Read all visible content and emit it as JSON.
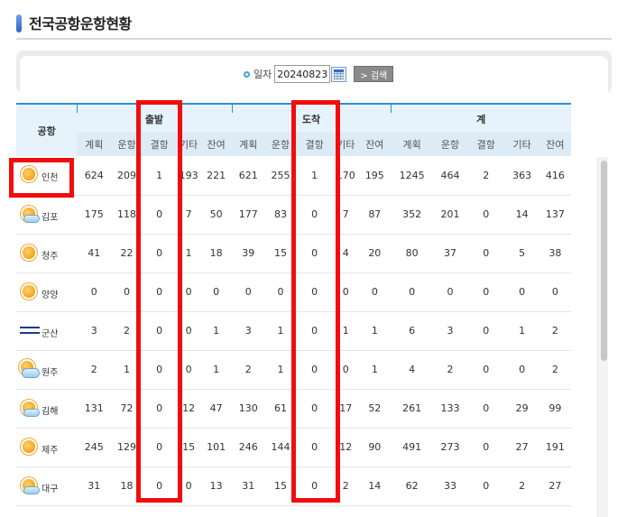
{
  "title": "전국공항운항현황",
  "search": {
    "date_label": "일자",
    "date_value": "20240823",
    "button_label": "> 검색",
    "calendar_icon": "calendar-icon"
  },
  "table": {
    "airport_header": "공항",
    "groups": [
      "출발",
      "도착",
      "계"
    ],
    "subheaders": [
      "계획",
      "운항",
      "결항",
      "기타",
      "잔여"
    ],
    "rows": [
      {
        "airport": "인천",
        "weather": "sunny",
        "dep": [
          "624",
          "209",
          "1",
          "193",
          "221"
        ],
        "arr": [
          "621",
          "255",
          "1",
          "170",
          "195"
        ],
        "tot": [
          "1245",
          "464",
          "2",
          "363",
          "416"
        ]
      },
      {
        "airport": "김포",
        "weather": "partly-cloudy",
        "dep": [
          "175",
          "118",
          "0",
          "7",
          "50"
        ],
        "arr": [
          "177",
          "83",
          "0",
          "7",
          "87"
        ],
        "tot": [
          "352",
          "201",
          "0",
          "14",
          "137"
        ]
      },
      {
        "airport": "청주",
        "weather": "sunny",
        "dep": [
          "41",
          "22",
          "0",
          "1",
          "18"
        ],
        "arr": [
          "39",
          "15",
          "0",
          "4",
          "20"
        ],
        "tot": [
          "80",
          "37",
          "0",
          "5",
          "38"
        ]
      },
      {
        "airport": "양양",
        "weather": "sunny",
        "dep": [
          "0",
          "0",
          "0",
          "0",
          "0"
        ],
        "arr": [
          "0",
          "0",
          "0",
          "0",
          "0"
        ],
        "tot": [
          "0",
          "0",
          "0",
          "0",
          "0"
        ]
      },
      {
        "airport": "군산",
        "weather": "fog",
        "dep": [
          "3",
          "2",
          "0",
          "0",
          "1"
        ],
        "arr": [
          "3",
          "1",
          "0",
          "1",
          "1"
        ],
        "tot": [
          "6",
          "3",
          "0",
          "1",
          "2"
        ]
      },
      {
        "airport": "원주",
        "weather": "cloudy",
        "dep": [
          "2",
          "1",
          "0",
          "0",
          "1"
        ],
        "arr": [
          "2",
          "1",
          "0",
          "0",
          "1"
        ],
        "tot": [
          "4",
          "2",
          "0",
          "0",
          "2"
        ]
      },
      {
        "airport": "김해",
        "weather": "partly-cloudy",
        "dep": [
          "131",
          "72",
          "0",
          "12",
          "47"
        ],
        "arr": [
          "130",
          "61",
          "0",
          "17",
          "52"
        ],
        "tot": [
          "261",
          "133",
          "0",
          "29",
          "99"
        ]
      },
      {
        "airport": "제주",
        "weather": "sunny",
        "dep": [
          "245",
          "129",
          "0",
          "15",
          "101"
        ],
        "arr": [
          "246",
          "144",
          "0",
          "12",
          "90"
        ],
        "tot": [
          "491",
          "273",
          "0",
          "27",
          "191"
        ]
      },
      {
        "airport": "대구",
        "weather": "partly-cloudy",
        "dep": [
          "31",
          "18",
          "0",
          "0",
          "13"
        ],
        "arr": [
          "31",
          "15",
          "0",
          "2",
          "14"
        ],
        "tot": [
          "62",
          "33",
          "0",
          "2",
          "27"
        ]
      }
    ]
  },
  "colors": {
    "accent": "#2a8fd6",
    "highlight": "#f20d0d",
    "header_bg": "#e6f3fc"
  }
}
